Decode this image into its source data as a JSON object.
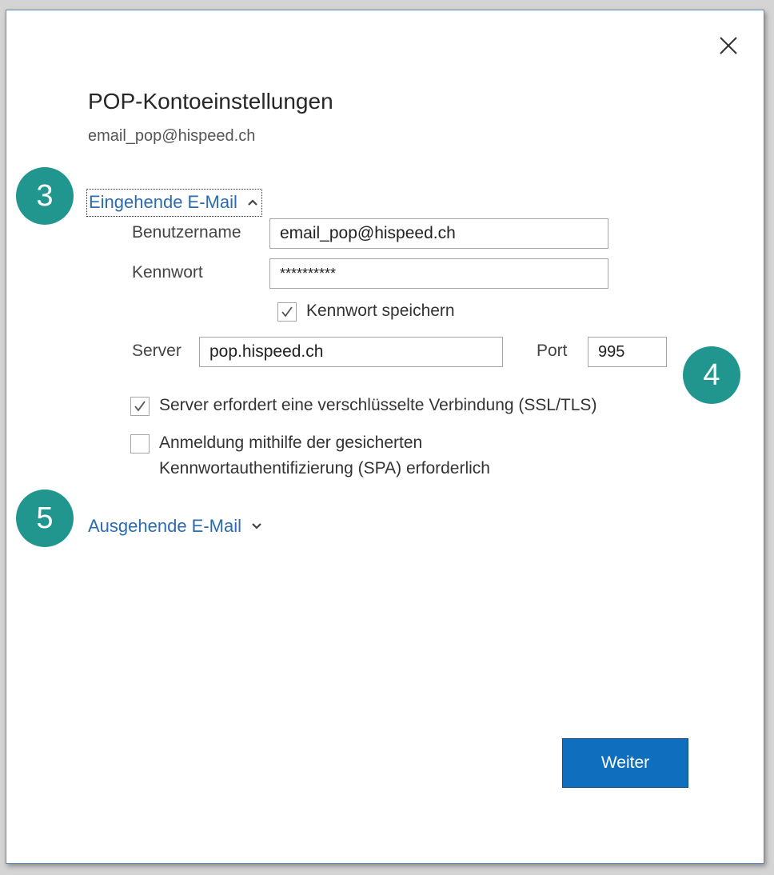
{
  "dialog": {
    "title": "POP-Kontoeinstellungen",
    "account_email": "email_pop@hispeed.ch"
  },
  "incoming": {
    "section_label": "Eingehende E-Mail",
    "username_label": "Benutzername",
    "username_value": "email_pop@hispeed.ch",
    "password_label": "Kennwort",
    "password_value": "**********",
    "save_password_label": "Kennwort speichern",
    "save_password_checked": true,
    "server_label": "Server",
    "server_value": "pop.hispeed.ch",
    "port_label": "Port",
    "port_value": "995",
    "ssl_label": "Server erfordert eine verschlüsselte Verbindung (SSL/TLS)",
    "ssl_checked": true,
    "spa_label_line1": "Anmeldung mithilfe der gesicherten",
    "spa_label_line2": "Kennwortauthentifizierung (SPA) erforderlich",
    "spa_checked": false
  },
  "outgoing": {
    "section_label": "Ausgehende E-Mail"
  },
  "badges": {
    "step3": "3",
    "step4": "4",
    "step5": "5"
  },
  "footer": {
    "next_label": "Weiter"
  },
  "colors": {
    "link": "#2b6cb0",
    "badge": "#21968f",
    "primary_button": "#106ebe"
  },
  "icons": {
    "close": "close-icon",
    "collapse": "chevron-up-icon",
    "expand": "chevron-down-icon",
    "check": "checkmark-icon"
  }
}
